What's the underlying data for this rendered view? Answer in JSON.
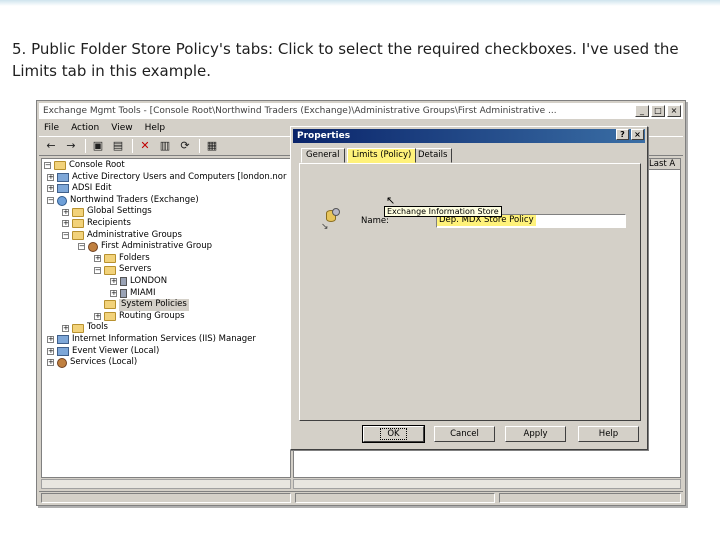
{
  "caption": "5. Public Folder Store Policy's tabs: Click to select the required checkboxes. I've used the Limits tab in this example.",
  "mmc": {
    "title": "Exchange Mgmt Tools - [Console Root\\Northwind Traders (Exchange)\\Administrative Groups\\First Administrative ...",
    "window_buttons": {
      "minimize": "_",
      "restore": "□",
      "close": "×"
    },
    "menu": [
      "File",
      "Action",
      "View",
      "Help"
    ],
    "right_column_header": "Last A",
    "tree": {
      "console_root": "Console Root",
      "aduc": "Active Directory Users and Computers [london.nor",
      "adsi_edit": "ADSI Edit",
      "northwind": "Northwind Traders (Exchange)",
      "global_settings": "Global Settings",
      "recipients": "Recipients",
      "administrative_groups": "Administrative Groups",
      "first_admin_group": "First Administrative Group",
      "folders": "Folders",
      "servers": "Servers",
      "london": "LONDON",
      "miami": "MIAMI",
      "system_policies": "System Policies",
      "routing_groups": "Routing Groups",
      "tools": "Tools",
      "iis_manager": "Internet Information Services (IIS) Manager",
      "event_viewer": "Event Viewer (Local)",
      "services": "Services (Local)"
    }
  },
  "dialog": {
    "title": "Properties",
    "help_button": "?",
    "close_button": "×",
    "tabs": [
      "General",
      "Limits (Policy)",
      "Details"
    ],
    "name_label": "Name:",
    "name_value": "Dep. MDX Store Policy",
    "tooltip": "Exchange Information Store",
    "buttons": {
      "ok": "OK",
      "cancel": "Cancel",
      "apply": "Apply",
      "help": "Help"
    }
  },
  "colors": {
    "highlight": "#fff27a",
    "dialog_title": "#0a246a"
  }
}
